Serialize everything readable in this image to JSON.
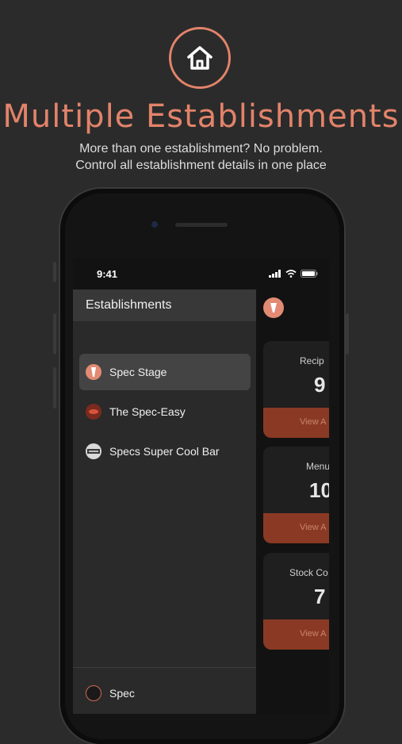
{
  "hero": {
    "icon": "house-icon",
    "title": "Multiple Establishments",
    "subtitle_line1": "More than one establishment? No problem.",
    "subtitle_line2": "Control all establishment details in one place"
  },
  "status_bar": {
    "time": "9:41"
  },
  "drawer": {
    "title": "Establishments",
    "items": [
      {
        "label": "Spec Stage",
        "active": true
      },
      {
        "label": "The Spec-Easy",
        "active": false
      },
      {
        "label": "Specs Super Cool Bar",
        "active": false
      }
    ],
    "footer_label": "Spec"
  },
  "dashboard": {
    "cards": [
      {
        "label": "Recip",
        "value": "9",
        "button": "View A"
      },
      {
        "label": "Menu",
        "value": "10",
        "button": "View A"
      },
      {
        "label": "Stock Co",
        "value": "7",
        "button": "View A"
      }
    ]
  },
  "colors": {
    "accent": "#e2836a",
    "background": "#2b2b2b",
    "button": "#8a3a24"
  }
}
